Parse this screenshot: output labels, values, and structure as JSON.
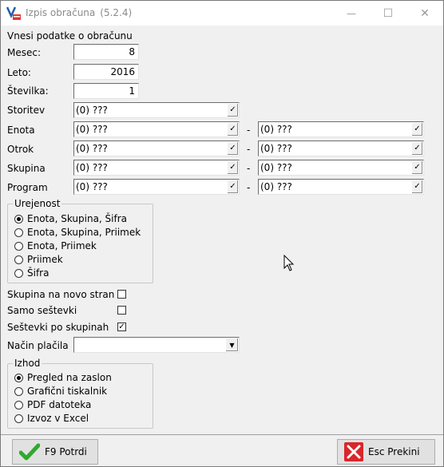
{
  "window": {
    "title": "Izpis obračuna",
    "version": "(5.2.4)"
  },
  "titlebar": {
    "minimize": "—",
    "maximize": "☐",
    "close": "✕"
  },
  "heading": "Vnesi podatke o obračunu",
  "fields": {
    "mesec": {
      "label": "Mesec:",
      "value": "8"
    },
    "leto": {
      "label": "Leto:",
      "value": "2016"
    },
    "stevilka": {
      "label": "Številka:",
      "value": "1"
    }
  },
  "lookups": [
    {
      "label": "Storitev",
      "from": "(0) ???",
      "to": null
    },
    {
      "label": "Enota",
      "from": "(0) ???",
      "to": "(0) ???"
    },
    {
      "label": "Otrok",
      "from": "(0) ???",
      "to": "(0) ???"
    },
    {
      "label": "Skupina",
      "from": "(0) ???",
      "to": "(0) ???"
    },
    {
      "label": "Program",
      "from": "(0) ???",
      "to": "(0) ???"
    }
  ],
  "range_separator": "-",
  "lookup_button": "✓",
  "sorting": {
    "legend": "Urejenost",
    "options": [
      "Enota, Skupina, Šifra",
      "Enota, Skupina, Priimek",
      "Enota, Priimek",
      "Priimek",
      "Šifra"
    ],
    "selected": 0
  },
  "checks": [
    {
      "label": "Skupina na novo stran",
      "checked": false,
      "mark": ""
    },
    {
      "label": "Samo seštevki",
      "checked": false,
      "mark": ""
    },
    {
      "label": "Seštevki po skupinah",
      "checked": true,
      "mark": "✓"
    }
  ],
  "payment": {
    "label": "Način plačila",
    "value": "",
    "arrow": "▼"
  },
  "output": {
    "legend": "Izhod",
    "options": [
      "Pregled na zaslon",
      "Grafični tiskalnik",
      "PDF datoteka",
      "Izvoz v Excel"
    ],
    "selected": 0
  },
  "buttons": {
    "confirm": "F9 Potrdi",
    "cancel": "Esc Prekini"
  },
  "colors": {
    "confirm_icon": "#2eaa2e",
    "cancel_icon": "#d9262b",
    "app_icon": "#1f5fb0"
  }
}
